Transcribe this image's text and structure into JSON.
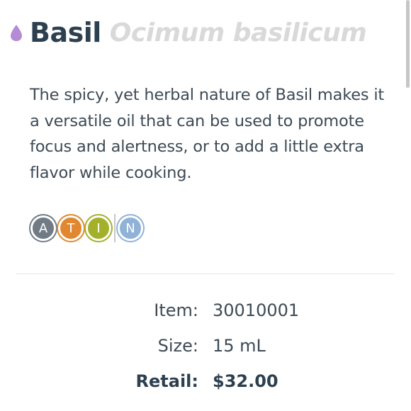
{
  "product": {
    "name": "Basil",
    "latin_name": "Ocimum basilicum",
    "description": "The spicy, yet herbal nature of Basil makes it a versatile oil that can be used to promote focus and alertness, or to add a little extra flavor while cooking.",
    "drop_icon": "oil-drop-icon",
    "drop_color": "#b58bd4"
  },
  "usage_badges": [
    {
      "letter": "A",
      "icon": "aromatic-badge-icon",
      "color": "#707b85"
    },
    {
      "letter": "T",
      "icon": "topical-badge-icon",
      "color": "#e0872f"
    },
    {
      "letter": "I",
      "icon": "internal-badge-icon",
      "color": "#a3b12a"
    },
    {
      "letter": "N",
      "icon": "neat-badge-icon",
      "color": "#8fb2d6"
    }
  ],
  "details": {
    "item_label": "Item:",
    "item_value": "30010001",
    "size_label": "Size:",
    "size_value": "15 mL",
    "retail_label": "Retail:",
    "retail_value": "$32.00"
  },
  "colors": {
    "heading": "#2d4050",
    "latin": "#d9d9d9",
    "body_text": "#3d4a55"
  }
}
